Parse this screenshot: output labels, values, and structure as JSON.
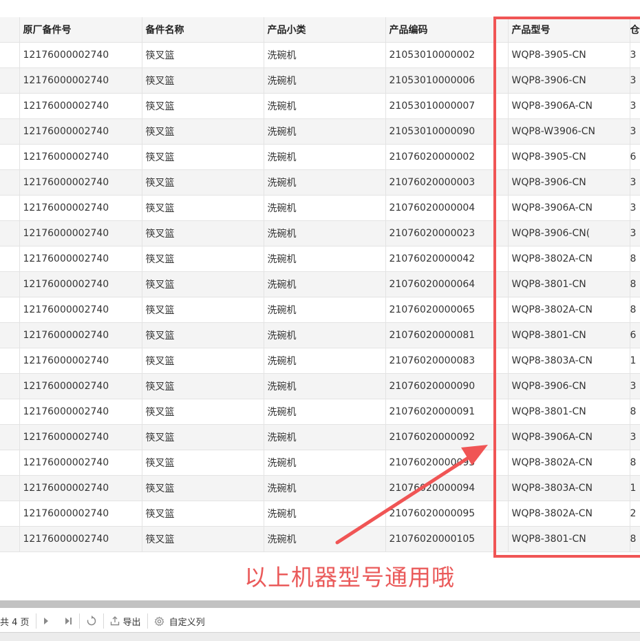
{
  "table": {
    "headers": [
      "原厂备件号",
      "备件名称",
      "产品小类",
      "产品编码",
      "产品型号",
      "仓"
    ],
    "rows": [
      [
        "12176000002740",
        "筷叉篮",
        "洗碗机",
        "21053010000002",
        "WQP8-3905-CN",
        "3"
      ],
      [
        "12176000002740",
        "筷叉篮",
        "洗碗机",
        "21053010000006",
        "WQP8-3906-CN",
        "3"
      ],
      [
        "12176000002740",
        "筷叉篮",
        "洗碗机",
        "21053010000007",
        "WQP8-3906A-CN",
        "3"
      ],
      [
        "12176000002740",
        "筷叉篮",
        "洗碗机",
        "21053010000090",
        "WQP8-W3906-CN",
        "3"
      ],
      [
        "12176000002740",
        "筷叉篮",
        "洗碗机",
        "21076020000002",
        "WQP8-3905-CN",
        "6"
      ],
      [
        "12176000002740",
        "筷叉篮",
        "洗碗机",
        "21076020000003",
        "WQP8-3906-CN",
        "3"
      ],
      [
        "12176000002740",
        "筷叉篮",
        "洗碗机",
        "21076020000004",
        "WQP8-3906A-CN",
        "3"
      ],
      [
        "12176000002740",
        "筷叉篮",
        "洗碗机",
        "21076020000023",
        "WQP8-3906-CN(",
        "3"
      ],
      [
        "12176000002740",
        "筷叉篮",
        "洗碗机",
        "21076020000042",
        "WQP8-3802A-CN",
        "8"
      ],
      [
        "12176000002740",
        "筷叉篮",
        "洗碗机",
        "21076020000064",
        "WQP8-3801-CN",
        "8"
      ],
      [
        "12176000002740",
        "筷叉篮",
        "洗碗机",
        "21076020000065",
        "WQP8-3802A-CN",
        "8"
      ],
      [
        "12176000002740",
        "筷叉篮",
        "洗碗机",
        "21076020000081",
        "WQP8-3801-CN",
        "6"
      ],
      [
        "12176000002740",
        "筷叉篮",
        "洗碗机",
        "21076020000083",
        "WQP8-3803A-CN",
        "1"
      ],
      [
        "12176000002740",
        "筷叉篮",
        "洗碗机",
        "21076020000090",
        "WQP8-3906-CN",
        "3"
      ],
      [
        "12176000002740",
        "筷叉篮",
        "洗碗机",
        "21076020000091",
        "WQP8-3801-CN",
        "8"
      ],
      [
        "12176000002740",
        "筷叉篮",
        "洗碗机",
        "21076020000092",
        "WQP8-3906A-CN",
        "3"
      ],
      [
        "12176000002740",
        "筷叉篮",
        "洗碗机",
        "21076020000093",
        "WQP8-3802A-CN",
        "8"
      ],
      [
        "12176000002740",
        "筷叉篮",
        "洗碗机",
        "21076020000094",
        "WQP8-3803A-CN",
        "1"
      ],
      [
        "12176000002740",
        "筷叉篮",
        "洗碗机",
        "21076020000095",
        "WQP8-3802A-CN",
        "2"
      ],
      [
        "12176000002740",
        "筷叉篮",
        "洗碗机",
        "21076020000105",
        "WQP8-3801-CN",
        "8"
      ]
    ]
  },
  "annotation": {
    "text": "以上机器型号通用哦",
    "color": "#ea5a5a"
  },
  "pager": {
    "page_info": "共 4 页",
    "next_icon": "next-page-icon",
    "last_icon": "last-page-icon",
    "refresh_icon": "refresh-icon",
    "export_icon": "export-icon",
    "export_label": "导出",
    "settings_icon": "gear-icon",
    "custom_columns_label": "自定义列"
  }
}
